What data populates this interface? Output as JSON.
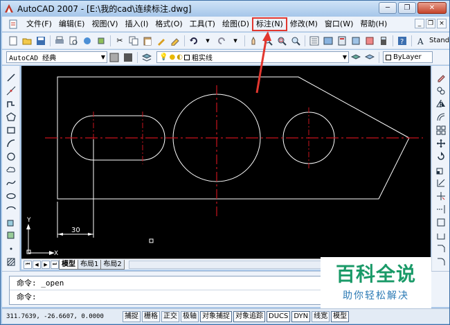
{
  "titlebar": {
    "title": "AutoCAD 2007 - [E:\\我的cad\\连续标注.dwg]",
    "minimize": "─",
    "restore": "❐",
    "close": "✕"
  },
  "menu": {
    "items": [
      {
        "label": "文件(F)"
      },
      {
        "label": "编辑(E)"
      },
      {
        "label": "视图(V)"
      },
      {
        "label": "插入(I)"
      },
      {
        "label": "格式(O)"
      },
      {
        "label": "工具(T)"
      },
      {
        "label": "绘图(D)"
      },
      {
        "label": "标注(N)",
        "highlighted": true
      },
      {
        "label": "修改(M)"
      },
      {
        "label": "窗口(W)"
      },
      {
        "label": "帮助(H)"
      }
    ],
    "mdi_min": "_",
    "mdi_restore": "❐",
    "mdi_close": "×"
  },
  "toolbar1": {
    "text_style_label": "Stand"
  },
  "toolbar2": {
    "workspace": "AutoCAD 经典",
    "layer_value": "粗实线",
    "color_value": "ByLayer"
  },
  "drawing": {
    "dimension_text": "30",
    "ucs_y": "Y",
    "ucs_x": "X"
  },
  "layout_tabs": [
    {
      "label": "模型",
      "active": true
    },
    {
      "label": "布局1",
      "active": false
    },
    {
      "label": "布局2",
      "active": false
    }
  ],
  "command": {
    "line1": "命令: _open",
    "line2": "命令:"
  },
  "watermark": {
    "title": "百科全说",
    "subtitle": "助你轻松解决"
  },
  "status": {
    "coordinates": "311.7639, -26.6607, 0.0000",
    "buttons": [
      {
        "label": "捕捉",
        "on": false
      },
      {
        "label": "栅格",
        "on": false
      },
      {
        "label": "正交",
        "on": false
      },
      {
        "label": "极轴",
        "on": false
      },
      {
        "label": "对象捕捉",
        "on": true
      },
      {
        "label": "对象追踪",
        "on": true
      },
      {
        "label": "DUCS",
        "on": true
      },
      {
        "label": "DYN",
        "on": true
      },
      {
        "label": "线宽",
        "on": false
      },
      {
        "label": "模型",
        "on": true
      }
    ]
  },
  "colors": {
    "highlight_box": "#e2372f",
    "watermark_green": "#1a9a68",
    "watermark_blue": "#2b7ab5",
    "centerline_red": "#c8141e",
    "geometry_white": "#ffffff"
  }
}
